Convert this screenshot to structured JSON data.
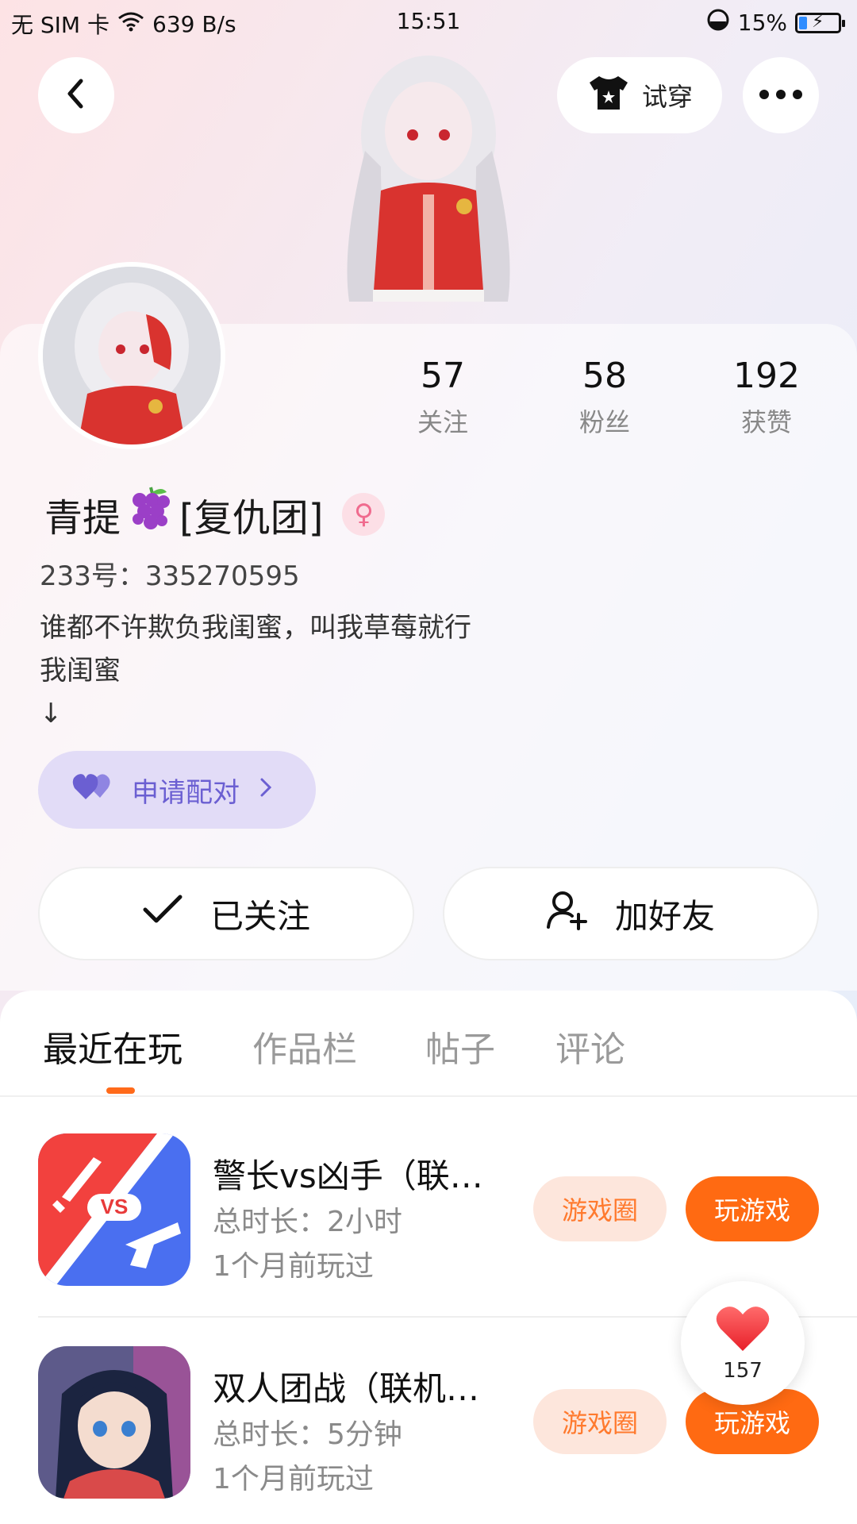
{
  "status_bar": {
    "carrier": "无 SIM 卡",
    "speed": "639 B/s",
    "time": "15:51",
    "battery": "15%"
  },
  "header": {
    "try_on_label": "试穿"
  },
  "profile": {
    "stats": [
      {
        "value": "57",
        "label": "关注"
      },
      {
        "value": "58",
        "label": "粉丝"
      },
      {
        "value": "192",
        "label": "获赞"
      }
    ],
    "nickname_prefix": "青提",
    "nickname_suffix": "[复仇团]",
    "uid": "233号：335270595",
    "bio": "谁都不许欺负我闺蜜，叫我草莓就行\n我闺蜜\n↓",
    "pair_button": "申请配对",
    "followed_button": "已关注",
    "add_friend_button": "加好友"
  },
  "tabs": [
    "最近在玩",
    "作品栏",
    "帖子",
    "评论"
  ],
  "games": [
    {
      "title": "警长vs凶手（联…",
      "duration": "总时长：2小时",
      "last_played": "1个月前玩过",
      "circle_label": "游戏圈",
      "play_label": "玩游戏",
      "icon_text": "VS"
    },
    {
      "title": "双人团战（联机…",
      "duration": "总时长：5分钟",
      "last_played": "1个月前玩过",
      "circle_label": "游戏圈",
      "play_label": "玩游戏"
    }
  ],
  "like_count": "157",
  "colors": {
    "accent_orange": "#ff6a12",
    "pair_purple": "#6b5fd2",
    "gender_pink": "#f06b8e"
  }
}
